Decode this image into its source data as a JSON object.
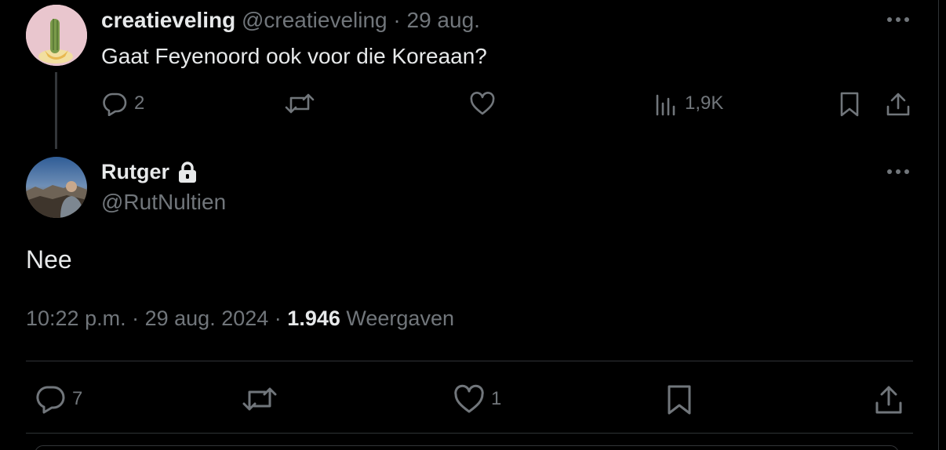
{
  "parent_tweet": {
    "display_name": "creatieveling",
    "handle": "@creatieveling",
    "separator": "·",
    "date": "29 aug.",
    "text": "Gaat Feyenoord ook voor die Koreaan?",
    "actions": {
      "replies": "2",
      "reposts": "",
      "likes": "",
      "views": "1,9K"
    }
  },
  "reply_tweet": {
    "display_name": "Rutger",
    "handle": "@RutNultien",
    "text": "Nee",
    "time": "10:22 p.m.",
    "separator": "·",
    "date": "29 aug. 2024",
    "views_count": "1.946",
    "views_label": "Weergaven",
    "actions": {
      "replies": "7",
      "reposts": "",
      "likes": "1"
    }
  },
  "colors": {
    "background": "#000000",
    "text_primary": "#e7e9ea",
    "text_secondary": "#71767b",
    "border": "#2f3336"
  },
  "icons": [
    "more-icon",
    "reply-icon",
    "repost-icon",
    "like-icon",
    "views-icon",
    "bookmark-icon",
    "share-icon",
    "lock-icon"
  ]
}
